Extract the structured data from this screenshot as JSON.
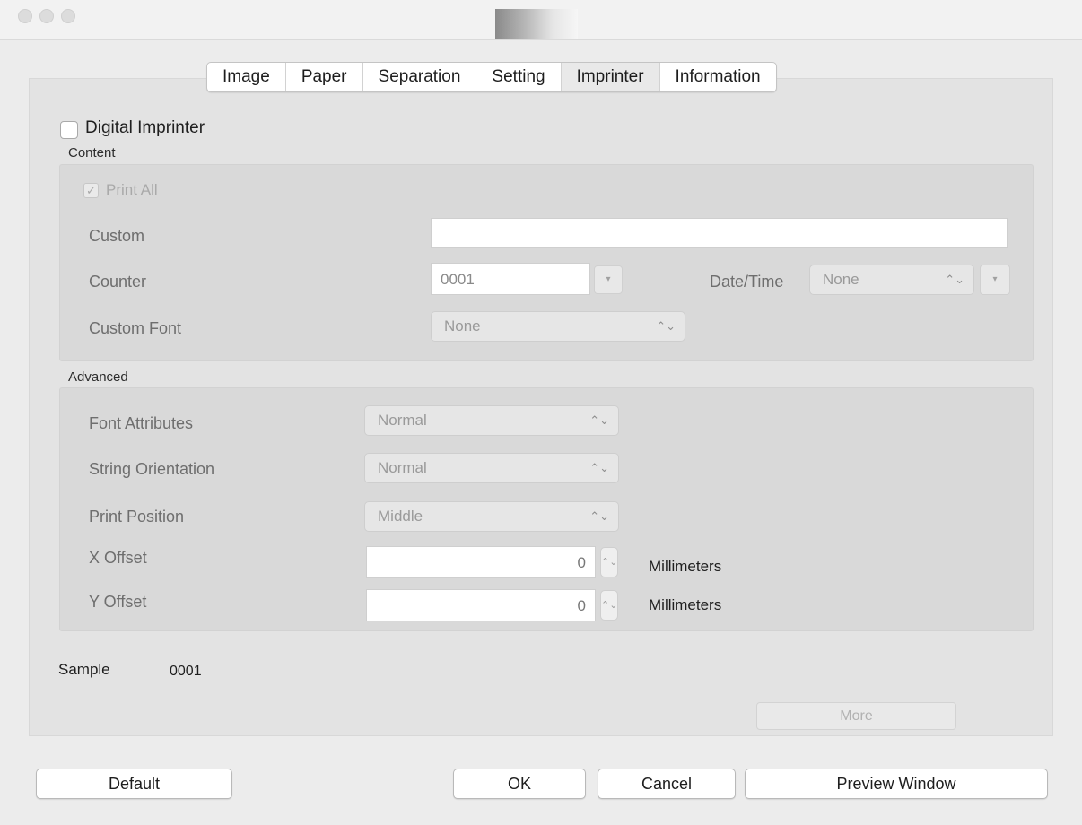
{
  "window": {
    "traffic_lights": [
      "close",
      "minimize",
      "zoom"
    ]
  },
  "tabs": [
    {
      "label": "Image"
    },
    {
      "label": "Paper"
    },
    {
      "label": "Separation"
    },
    {
      "label": "Setting"
    },
    {
      "label": "Imprinter",
      "selected": true
    },
    {
      "label": "Information"
    }
  ],
  "imprinter": {
    "digital_imprinter_label": "Digital Imprinter",
    "digital_imprinter_checked": false
  },
  "content": {
    "title": "Content",
    "print_all_label": "Print All",
    "print_all_checked": true,
    "custom_label": "Custom",
    "custom_value": "",
    "counter_label": "Counter",
    "counter_value": "0001",
    "datetime_label": "Date/Time",
    "datetime_value": "None",
    "custom_font_label": "Custom Font",
    "custom_font_value": "None"
  },
  "advanced": {
    "title": "Advanced",
    "font_attributes_label": "Font Attributes",
    "font_attributes_value": "Normal",
    "string_orientation_label": "String Orientation",
    "string_orientation_value": "Normal",
    "print_position_label": "Print Position",
    "print_position_value": "Middle",
    "x_offset_label": "X Offset",
    "x_offset_value": "0",
    "x_offset_unit": "Millimeters",
    "y_offset_label": "Y Offset",
    "y_offset_value": "0",
    "y_offset_unit": "Millimeters"
  },
  "sample": {
    "label": "Sample",
    "value": "0001"
  },
  "more_label": "More",
  "footer": {
    "default_label": "Default",
    "ok_label": "OK",
    "cancel_label": "Cancel",
    "preview_label": "Preview Window"
  },
  "colors": {
    "window_bg": "#ececec",
    "panel_bg": "#e3e3e3",
    "group_bg": "#d9d9d9",
    "disabled_text": "#a9a9a9"
  }
}
